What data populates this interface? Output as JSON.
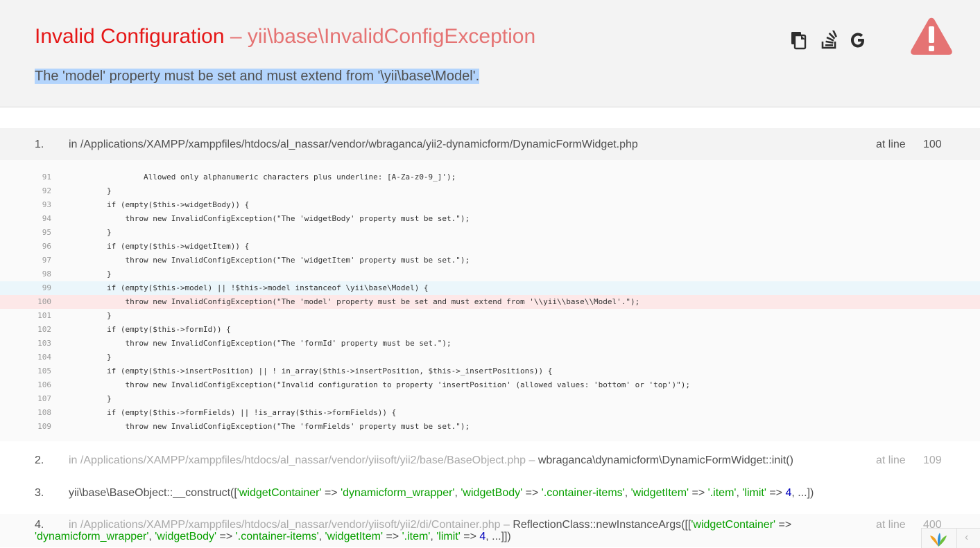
{
  "header": {
    "error_name": "Invalid Configuration",
    "separator": "–",
    "exception_class": "yii\\base\\InvalidConfigException",
    "message": "The 'model' property must be set and must extend from '\\yii\\base\\Model'.",
    "message_trailing": ".",
    "icons": [
      "copy-icon",
      "stackoverflow-icon",
      "google-icon",
      "warning-icon"
    ],
    "colors": {
      "title": "#e51717",
      "exception": "#e57373",
      "warning": "#e57373",
      "background": "#f3f3f3"
    }
  },
  "frames": [
    {
      "number": "1.",
      "file": "in /Applications/XAMPP/xamppfiles/htdocs/al_nassar/vendor/wbraganca/yii2-dynamicform/DynamicFormWidget.php",
      "at_label": "at line",
      "line": "100"
    },
    {
      "number": "2.",
      "file": "in /Applications/XAMPP/xamppfiles/htdocs/al_nassar/vendor/yiisoft/yii2/base/BaseObject.php",
      "call_sep": " – ",
      "call": "wbraganca\\dynamicform\\DynamicFormWidget::init()",
      "at_label": "at line",
      "line": "109"
    },
    {
      "number": "3.",
      "call_prefix": "yii\\base\\BaseObject::__construct([",
      "args": [
        {
          "key": "'widgetContainer'",
          "arrow": " => ",
          "value": "'dynamicform_wrapper'",
          "comma": ", "
        },
        {
          "key": "'widgetBody'",
          "arrow": " => ",
          "value": "'.container-items'",
          "comma": ", "
        },
        {
          "key": "'widgetItem'",
          "arrow": " => ",
          "value": "'.item'",
          "comma": ", "
        },
        {
          "key": "'limit'",
          "arrow": " => "
        }
      ],
      "limit_value": "4",
      "call_suffix": ", ...])"
    },
    {
      "number": "4.",
      "file": "in /Applications/XAMPP/xamppfiles/htdocs/al_nassar/vendor/yiisoft/yii2/di/Container.php",
      "call_sep": " – ",
      "call_prefix": "ReflectionClass::newInstanceArgs([[",
      "first_key": "'widgetContainer'",
      "first_arrow": " =>",
      "wrap_first_value": "'dynamicform_wrapper'",
      "wrap_args": [
        {
          "comma": ", ",
          "key": "'widgetBody'",
          "arrow": " => ",
          "value": "'.container-items'"
        },
        {
          "comma": ", ",
          "key": "'widgetItem'",
          "arrow": " => ",
          "value": "'.item'"
        },
        {
          "comma": ", ",
          "key": "'limit'",
          "arrow": " => "
        }
      ],
      "limit_value": "4",
      "call_suffix": ", ...]])",
      "at_label": "at line",
      "line": "400"
    }
  ],
  "code": {
    "error_line": "100",
    "call_line": "99",
    "lines": [
      {
        "n": "91",
        "text": "                Allowed only alphanumeric characters plus underline: [A-Za-z0-9_]');"
      },
      {
        "n": "92",
        "text": "        }"
      },
      {
        "n": "93",
        "text": "        if (empty($this->widgetBody)) {"
      },
      {
        "n": "94",
        "text": "            throw new InvalidConfigException(\"The 'widgetBody' property must be set.\");"
      },
      {
        "n": "95",
        "text": "        }"
      },
      {
        "n": "96",
        "text": "        if (empty($this->widgetItem)) {"
      },
      {
        "n": "97",
        "text": "            throw new InvalidConfigException(\"The 'widgetItem' property must be set.\");"
      },
      {
        "n": "98",
        "text": "        }"
      },
      {
        "n": "99",
        "text": "        if (empty($this->model) || !$this->model instanceof \\yii\\base\\Model) {"
      },
      {
        "n": "100",
        "text": "            throw new InvalidConfigException(\"The 'model' property must be set and must extend from '\\\\yii\\\\base\\\\Model'.\");"
      },
      {
        "n": "101",
        "text": "        }"
      },
      {
        "n": "102",
        "text": "        if (empty($this->formId)) {"
      },
      {
        "n": "103",
        "text": "            throw new InvalidConfigException(\"The 'formId' property must be set.\");"
      },
      {
        "n": "104",
        "text": "        }"
      },
      {
        "n": "105",
        "text": "        if (empty($this->insertPosition) || ! in_array($this->insertPosition, $this->_insertPositions)) {"
      },
      {
        "n": "106",
        "text": "            throw new InvalidConfigException(\"Invalid configuration to property 'insertPosition' (allowed values: 'bottom' or 'top')\");"
      },
      {
        "n": "107",
        "text": "        }"
      },
      {
        "n": "108",
        "text": "        if (empty($this->formFields) || !is_array($this->formFields)) {"
      },
      {
        "n": "109",
        "text": "            throw new InvalidConfigException(\"The 'formFields' property must be set.\");"
      }
    ]
  },
  "toolbar": {
    "icons": [
      "yii-logo-icon",
      "chevron-left-icon"
    ],
    "chevron": "‹"
  }
}
